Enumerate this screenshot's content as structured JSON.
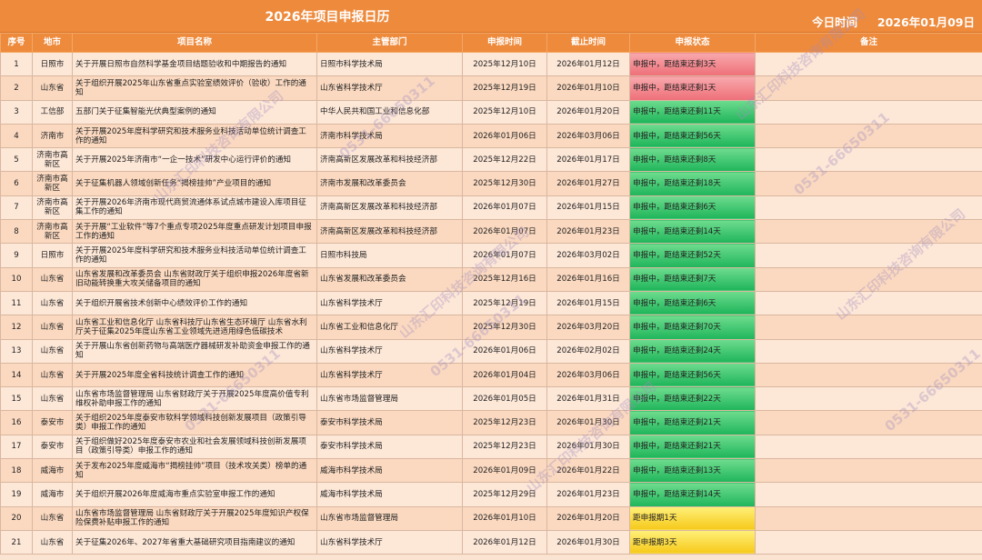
{
  "header": {
    "title": "2026年项目申报日历",
    "today_label": "今日时间",
    "today_date": "2026年01月09日"
  },
  "columns": [
    "序号",
    "地市",
    "项目名称",
    "主管部门",
    "申报时间",
    "截止时间",
    "申报状态",
    "备注"
  ],
  "rows": [
    {
      "no": "1",
      "city": "日照市",
      "name": "关于开展日照市自然科学基金项目结题验收和中期报告的通知",
      "dept": "日照市科学技术局",
      "start": "2025年12月10日",
      "end": "2026年01月12日",
      "status": "申报中，距结束还剩3天",
      "status_color": "red"
    },
    {
      "no": "2",
      "city": "山东省",
      "name": "关于组织开展2025年山东省重点实验室绩效评价（验收）工作的通知",
      "dept": "山东省科学技术厅",
      "start": "2025年12月19日",
      "end": "2026年01月10日",
      "status": "申报中，距结束还剩1天",
      "status_color": "red"
    },
    {
      "no": "3",
      "city": "工信部",
      "name": "五部门关于征集智能光伏典型案例的通知",
      "dept": "中华人民共和国工业和信息化部",
      "start": "2025年12月10日",
      "end": "2026年01月20日",
      "status": "申报中，距结束还剩11天",
      "status_color": "green"
    },
    {
      "no": "4",
      "city": "济南市",
      "name": "关于开展2025年度科学研究和技术服务业科技活动单位统计调查工作的通知",
      "dept": "济南市科学技术局",
      "start": "2026年01月06日",
      "end": "2026年03月06日",
      "status": "申报中，距结束还剩56天",
      "status_color": "green"
    },
    {
      "no": "5",
      "city": "济南市高新区",
      "name": "关于开展2025年济南市“一企一技术”研发中心运行评价的通知",
      "dept": "济南高新区发展改革和科技经济部",
      "start": "2025年12月22日",
      "end": "2026年01月17日",
      "status": "申报中，距结束还剩8天",
      "status_color": "green"
    },
    {
      "no": "6",
      "city": "济南市高新区",
      "name": "关于征集机器人领域创新任务“揭榜挂帅”产业项目的通知",
      "dept": "济南市发展和改革委员会",
      "start": "2025年12月30日",
      "end": "2026年01月27日",
      "status": "申报中，距结束还剩18天",
      "status_color": "green"
    },
    {
      "no": "7",
      "city": "济南市高新区",
      "name": "关于开展2026年济南市现代商贸流通体系试点城市建设入库项目征集工作的通知",
      "dept": "济南高新区发展改革和科技经济部",
      "start": "2026年01月07日",
      "end": "2026年01月15日",
      "status": "申报中，距结束还剩6天",
      "status_color": "green"
    },
    {
      "no": "8",
      "city": "济南市高新区",
      "name": "关于开展“工业软件”等7个重点专项2025年度重点研发计划项目申报工作的通知",
      "dept": "济南高新区发展改革和科技经济部",
      "start": "2026年01月07日",
      "end": "2026年01月23日",
      "status": "申报中，距结束还剩14天",
      "status_color": "green"
    },
    {
      "no": "9",
      "city": "日照市",
      "name": "关于开展2025年度科学研究和技术服务业科技活动单位统计调查工作的通知",
      "dept": "日照市科技局",
      "start": "2026年01月07日",
      "end": "2026年03月02日",
      "status": "申报中，距结束还剩52天",
      "status_color": "green"
    },
    {
      "no": "10",
      "city": "山东省",
      "name": "山东省发展和改革委员会 山东省财政厅关于组织申报2026年度省新旧动能转换重大攻关储备项目的通知",
      "dept": "山东省发展和改革委员会",
      "start": "2025年12月16日",
      "end": "2026年01月16日",
      "status": "申报中，距结束还剩7天",
      "status_color": "green"
    },
    {
      "no": "11",
      "city": "山东省",
      "name": "关于组织开展省技术创新中心绩效评价工作的通知",
      "dept": "山东省科学技术厅",
      "start": "2025年12月19日",
      "end": "2026年01月15日",
      "status": "申报中，距结束还剩6天",
      "status_color": "green"
    },
    {
      "no": "12",
      "city": "山东省",
      "name": "山东省工业和信息化厅 山东省科技厅山东省生态环境厅 山东省水利厅关于征集2025年度山东省工业领域先进适用绿色低碳技术",
      "dept": "山东省工业和信息化厅",
      "start": "2025年12月30日",
      "end": "2026年03月20日",
      "status": "申报中，距结束还剩70天",
      "status_color": "green"
    },
    {
      "no": "13",
      "city": "山东省",
      "name": "关于开展山东省创新药物与高端医疗器械研发补助资金申报工作的通知",
      "dept": "山东省科学技术厅",
      "start": "2026年01月06日",
      "end": "2026年02月02日",
      "status": "申报中，距结束还剩24天",
      "status_color": "green"
    },
    {
      "no": "14",
      "city": "山东省",
      "name": "关于开展2025年度全省科技统计调查工作的通知",
      "dept": "山东省科学技术厅",
      "start": "2026年01月04日",
      "end": "2026年03月06日",
      "status": "申报中，距结束还剩56天",
      "status_color": "green"
    },
    {
      "no": "15",
      "city": "山东省",
      "name": "山东省市场监督管理局 山东省财政厅关于开展2025年度高价值专利维权补助申报工作的通知",
      "dept": "山东省市场监督管理局",
      "start": "2026年01月05日",
      "end": "2026年01月31日",
      "status": "申报中，距结束还剩22天",
      "status_color": "green"
    },
    {
      "no": "16",
      "city": "泰安市",
      "name": "关于组织2025年度泰安市软科学领域科技创新发展项目（政策引导类）申报工作的通知",
      "dept": "泰安市科学技术局",
      "start": "2025年12月23日",
      "end": "2026年01月30日",
      "status": "申报中，距结束还剩21天",
      "status_color": "green"
    },
    {
      "no": "17",
      "city": "泰安市",
      "name": "关于组织做好2025年度泰安市农业和社会发展领域科技创新发展项目（政策引导类）申报工作的通知",
      "dept": "泰安市科学技术局",
      "start": "2025年12月23日",
      "end": "2026年01月30日",
      "status": "申报中，距结束还剩21天",
      "status_color": "green"
    },
    {
      "no": "18",
      "city": "威海市",
      "name": "关于发布2025年度威海市“揭榜挂帅”项目（技术攻关类）榜单的通知",
      "dept": "威海市科学技术局",
      "start": "2026年01月09日",
      "end": "2026年01月22日",
      "status": "申报中，距结束还剩13天",
      "status_color": "green"
    },
    {
      "no": "19",
      "city": "威海市",
      "name": "关于组织开展2026年度威海市重点实验室申报工作的通知",
      "dept": "威海市科学技术局",
      "start": "2025年12月29日",
      "end": "2026年01月23日",
      "status": "申报中，距结束还剩14天",
      "status_color": "green"
    },
    {
      "no": "20",
      "city": "山东省",
      "name": "山东省市场监督管理局 山东省财政厅关于开展2025年度知识产权保险保费补贴申报工作的通知",
      "dept": "山东省市场监督管理局",
      "start": "2026年01月10日",
      "end": "2026年01月20日",
      "status": "距申报期1天",
      "status_color": "yellow"
    },
    {
      "no": "21",
      "city": "山东省",
      "name": "关于征集2026年、2027年省重大基础研究项目指南建议的通知",
      "dept": "山东省科学技术厅",
      "start": "2026年01月12日",
      "end": "2026年01月30日",
      "status": "距申报期3天",
      "status_color": "yellow"
    }
  ],
  "watermark": {
    "company": "山东汇印科技咨询有限公司",
    "phone": "0531-66650311"
  }
}
